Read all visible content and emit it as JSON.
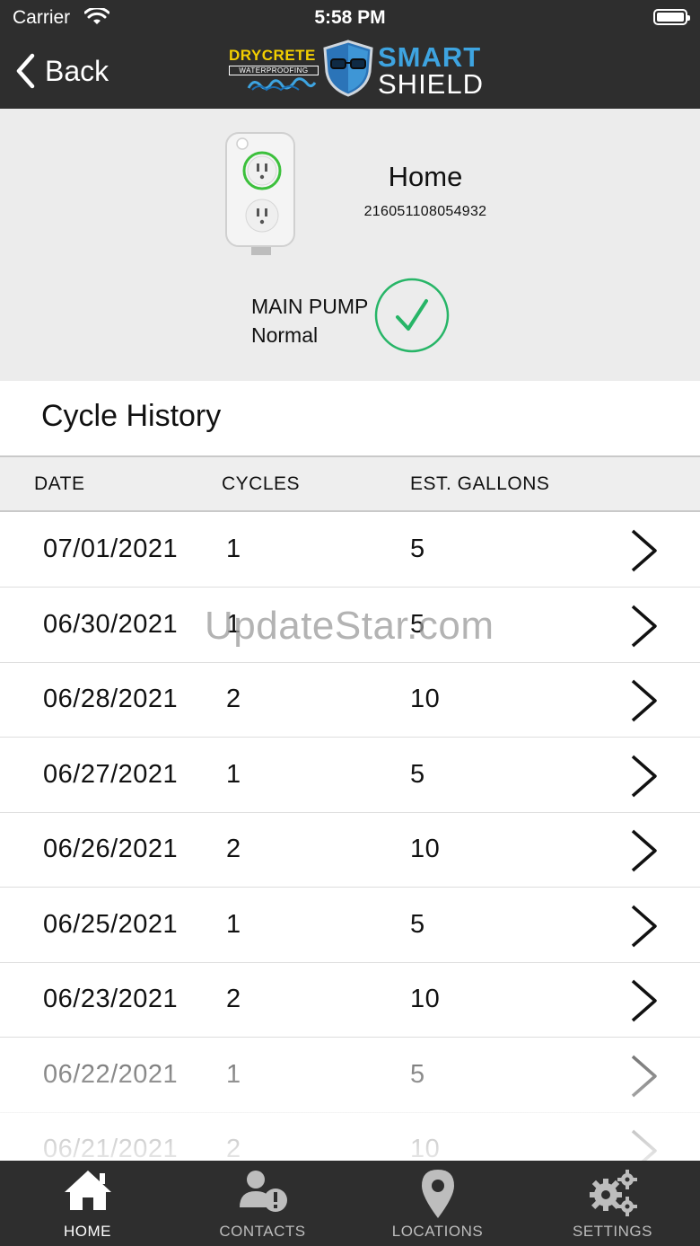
{
  "status_bar": {
    "carrier": "Carrier",
    "time": "5:58 PM"
  },
  "nav": {
    "back_label": "Back"
  },
  "logo": {
    "drycrete": "DRYCRETE",
    "waterproofing": "WATERPROOFING",
    "smart": "SMART",
    "shield": "SHIELD"
  },
  "device": {
    "name": "Home",
    "serial": "216051108054932",
    "pump_label": "MAIN PUMP",
    "pump_status": "Normal"
  },
  "history": {
    "title": "Cycle History",
    "columns": {
      "date": "DATE",
      "cycles": "CYCLES",
      "gallons": "EST. GALLONS"
    },
    "rows": [
      {
        "date": "07/01/2021",
        "cycles": "1",
        "gallons": "5"
      },
      {
        "date": "06/30/2021",
        "cycles": "1",
        "gallons": "5"
      },
      {
        "date": "06/28/2021",
        "cycles": "2",
        "gallons": "10"
      },
      {
        "date": "06/27/2021",
        "cycles": "1",
        "gallons": "5"
      },
      {
        "date": "06/26/2021",
        "cycles": "2",
        "gallons": "10"
      },
      {
        "date": "06/25/2021",
        "cycles": "1",
        "gallons": "5"
      },
      {
        "date": "06/23/2021",
        "cycles": "2",
        "gallons": "10"
      },
      {
        "date": "06/22/2021",
        "cycles": "1",
        "gallons": "5"
      },
      {
        "date": "06/21/2021",
        "cycles": "2",
        "gallons": "10"
      }
    ]
  },
  "watermark": "UpdateStar.com",
  "tabs": [
    {
      "label": "HOME",
      "icon": "home-icon",
      "active": true
    },
    {
      "label": "CONTACTS",
      "icon": "contacts-alert-icon",
      "active": false
    },
    {
      "label": "LOCATIONS",
      "icon": "location-pin-icon",
      "active": false
    },
    {
      "label": "SETTINGS",
      "icon": "gears-icon",
      "active": false
    }
  ],
  "colors": {
    "header_bg": "#2e2e2e",
    "accent_green": "#27b567",
    "smart_blue": "#3ea4e0",
    "drycrete_yellow": "#f4d000"
  }
}
